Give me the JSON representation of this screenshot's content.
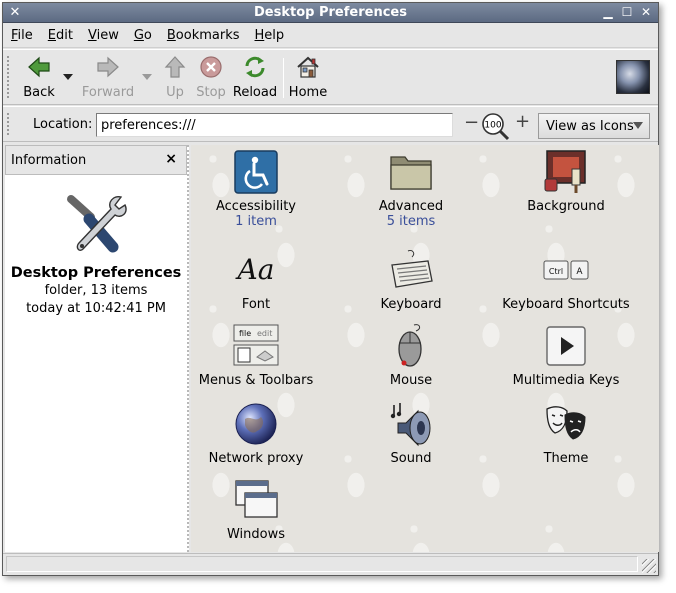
{
  "window": {
    "title": "Desktop Preferences"
  },
  "menubar": [
    {
      "underline": "F",
      "rest": "ile"
    },
    {
      "underline": "E",
      "rest": "dit"
    },
    {
      "underline": "V",
      "rest": "iew"
    },
    {
      "underline": "G",
      "rest": "o"
    },
    {
      "underline": "B",
      "rest": "ookmarks"
    },
    {
      "underline": "H",
      "rest": "elp"
    }
  ],
  "toolbar": {
    "back": "Back",
    "forward": "Forward",
    "up": "Up",
    "stop": "Stop",
    "reload": "Reload",
    "home": "Home"
  },
  "location": {
    "label": "Location:",
    "value": "preferences:///",
    "zoom": "100",
    "view_mode": "View as Icons"
  },
  "sidebar": {
    "header": "Information",
    "close": "×",
    "title": "Desktop Preferences",
    "info_line1": "folder, 13 items",
    "info_line2": "today at 10:42:41 PM"
  },
  "items": [
    {
      "name": "Accessibility",
      "sub": "1 item",
      "icon": "accessibility-icon"
    },
    {
      "name": "Advanced",
      "sub": "5 items",
      "icon": "folder-icon"
    },
    {
      "name": "Background",
      "sub": "",
      "icon": "background-icon"
    },
    {
      "name": "Font",
      "sub": "",
      "icon": "font-icon",
      "glyph": "Aa"
    },
    {
      "name": "Keyboard",
      "sub": "",
      "icon": "keyboard-icon"
    },
    {
      "name": "Keyboard Shortcuts",
      "sub": "",
      "icon": "keyboard-shortcuts-icon",
      "keys": [
        "Ctrl",
        "A"
      ]
    },
    {
      "name": "Menus & Toolbars",
      "sub": "",
      "icon": "menus-toolbars-icon",
      "mini": [
        "file",
        "edit"
      ]
    },
    {
      "name": "Mouse",
      "sub": "",
      "icon": "mouse-icon"
    },
    {
      "name": "Multimedia Keys",
      "sub": "",
      "icon": "multimedia-keys-icon"
    },
    {
      "name": "Network proxy",
      "sub": "",
      "icon": "network-proxy-icon"
    },
    {
      "name": "Sound",
      "sub": "",
      "icon": "sound-icon"
    },
    {
      "name": "Theme",
      "sub": "",
      "icon": "theme-icon"
    },
    {
      "name": "Windows",
      "sub": "",
      "icon": "windows-icon"
    }
  ],
  "colors": {
    "titlebar": "#6d7a91",
    "link_blue": "#3a4f9a",
    "icon_bg": "#e5e3de"
  }
}
